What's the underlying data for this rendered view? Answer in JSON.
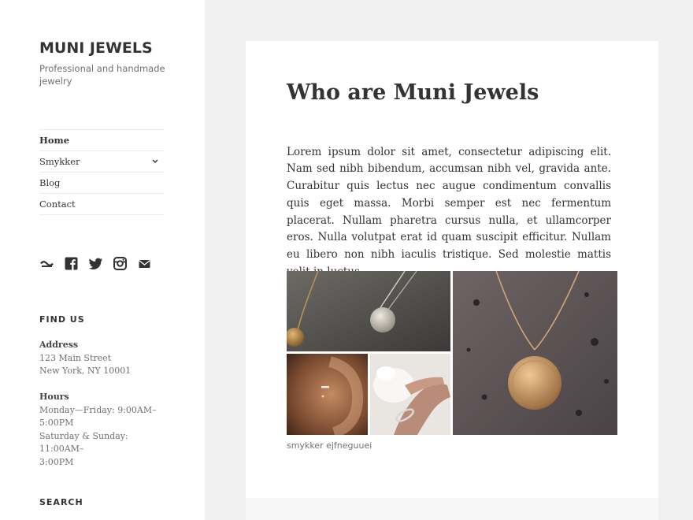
{
  "site": {
    "title": "MUNI JEWELS",
    "description": "Professional and handmade jewelry"
  },
  "nav": {
    "items": [
      {
        "label": "Home",
        "current": true
      },
      {
        "label": "Smykker",
        "has_submenu": true
      },
      {
        "label": "Blog"
      },
      {
        "label": "Contact"
      }
    ]
  },
  "social": {
    "icons": [
      "codepen-icon",
      "facebook-icon",
      "twitter-icon",
      "instagram-icon",
      "email-icon"
    ]
  },
  "find_us": {
    "title": "FIND US",
    "address_label": "Address",
    "address_line1": "123 Main Street",
    "address_line2": "New York, NY 10001",
    "hours_label": "Hours",
    "hours_line1": "Monday—Friday: 9:00AM–",
    "hours_line2": "5:00PM",
    "hours_line3": "Saturday & Sunday: 11:00AM–",
    "hours_line4": "3:00PM"
  },
  "search": {
    "title": "SEARCH"
  },
  "entry": {
    "title": "Who are Muni Jewels",
    "body": "Lorem ipsum dolor sit amet, consectetur adipiscing elit. Nam sed nibh bibendum, accumsan nibh vel, gravida ante. Curabitur quis lectus nec augue condimentum convallis quis eget massa. Morbi semper est nec fermentum placerat. Nullam pharetra cursus nulla, et ullamcorper eros. Nulla volutpat erat id quam suscipit efficitur. Nullam eu libero non nibh iaculis tristique. Sed molestie mattis velit in luctus.",
    "gallery_caption": "smykker ejfneguuei"
  },
  "colors": {
    "background": "#f1f1f1",
    "card": "#ffffff",
    "text": "#333333",
    "muted": "#707070"
  }
}
